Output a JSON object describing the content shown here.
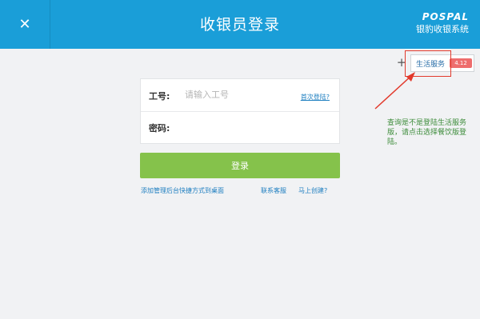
{
  "header": {
    "title": "收银员登录",
    "brand_en": "POSPAL",
    "brand_cn": "银豹收银系统",
    "close_glyph": "✕"
  },
  "top_right": {
    "plus_glyph": "+",
    "service_tab_label": "生活服务",
    "service_badge": "4.12"
  },
  "annotation": {
    "text": "查询是不是登陆生活服务版，请点击选择餐饮版登陆。"
  },
  "form": {
    "user_label": "工号:",
    "user_placeholder": "请输入工号",
    "user_value": "",
    "first_login_link": "首次登陆?",
    "password_label": "密码:",
    "password_value": "",
    "login_button": "登录"
  },
  "footer_links": {
    "add_shortcut": "添加管理后台快捷方式到桌面",
    "contact_service": "联系客服",
    "create_now": "马上创建?"
  },
  "colors": {
    "header_bg": "#1a9ed8",
    "login_button": "#85c24b",
    "link": "#1f7fc0",
    "annotation": "#3d8c3a",
    "highlight": "#e23a2c"
  }
}
